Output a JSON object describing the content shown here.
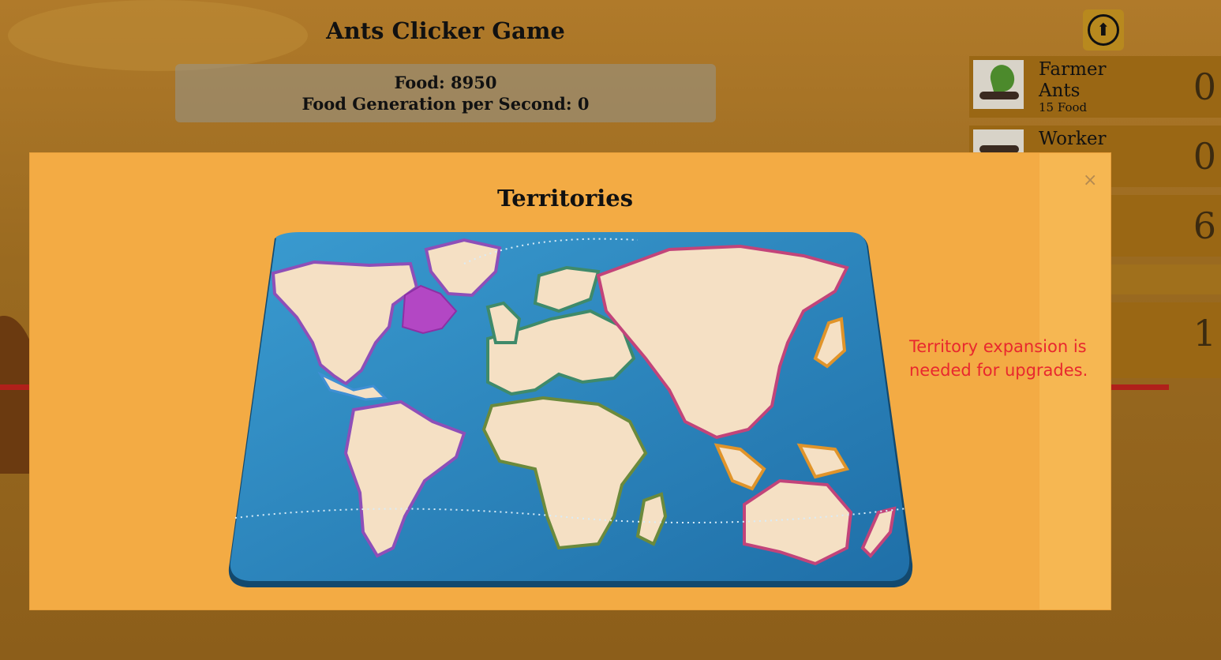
{
  "game": {
    "title": "Ants Clicker Game",
    "food_label": "Food: 8950",
    "gen_label": "Food Generation per Second: 0"
  },
  "upgrades": [
    {
      "name_line1": "Farmer",
      "name_line2": "Ants",
      "cost": "15 Food",
      "count": "0"
    },
    {
      "name_line1": "Worker",
      "name_line2": "",
      "cost": "",
      "count": "0"
    },
    {
      "name_line1": "",
      "name_line2": "",
      "cost": "",
      "count": "6"
    },
    {
      "name_line1": "",
      "name_line2": "",
      "cost": "",
      "count": "1"
    }
  ],
  "modal": {
    "title": "Territories",
    "close_symbol": "×",
    "notice_line1": "Territory expansion is",
    "notice_line2": "needed for upgrades."
  },
  "icons": {
    "upload": "upload-arrow-icon",
    "close": "close-icon"
  },
  "colors": {
    "selected_territory": "#b347c4",
    "ocean": "#2a86bf",
    "notice": "#e8282e"
  }
}
